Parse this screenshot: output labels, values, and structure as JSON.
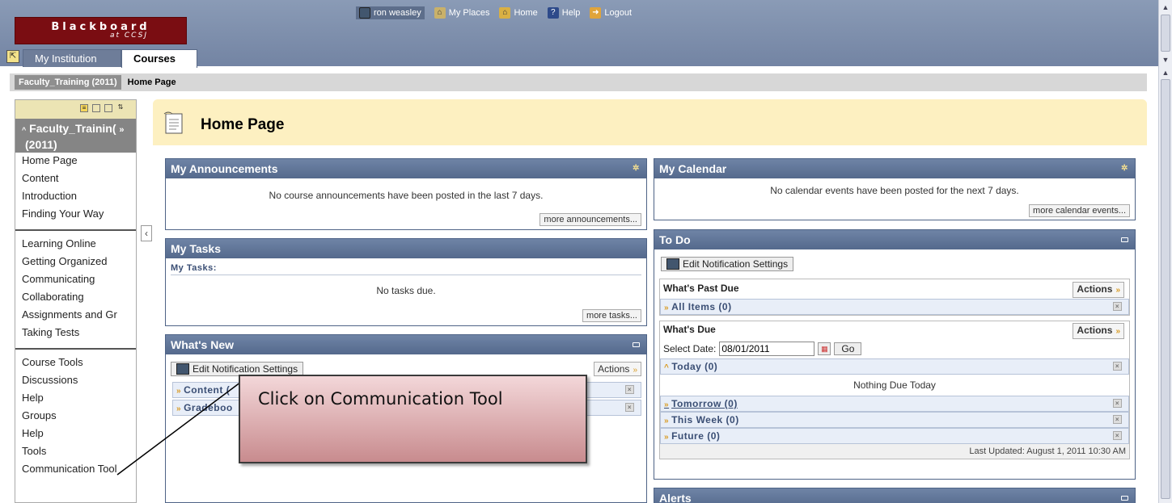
{
  "header": {
    "logo_line1": "Blackboard",
    "logo_line2": "at CCSJ",
    "user": "ron weasley",
    "links": [
      "My Places",
      "Home",
      "Help",
      "Logout"
    ]
  },
  "tabs": {
    "institution": "My Institution",
    "courses": "Courses"
  },
  "breadcrumb": {
    "course": "Faculty_Training (2011)",
    "page": "Home Page"
  },
  "course_menu": {
    "title": "Faculty_Training (2011)",
    "title_line1": "Faculty_Trainin(",
    "title_line2": "(2011)",
    "group1": [
      "Home Page",
      "Content",
      "Introduction",
      "Finding Your Way"
    ],
    "group2": [
      "Learning Online",
      "Getting Organized",
      "Communicating",
      "Collaborating",
      "Assignments and Gr",
      "Taking Tests"
    ],
    "group3": [
      "Course Tools",
      "Discussions",
      "Help",
      "Groups",
      "Help",
      "Tools",
      "Communication Tool"
    ]
  },
  "page_title": "Home Page",
  "announcements": {
    "title": "My Announcements",
    "message": "No course announcements have been posted in the last 7 days.",
    "more": "more announcements..."
  },
  "tasks": {
    "title": "My Tasks",
    "subheading": "My Tasks:",
    "message": "No tasks due.",
    "more": "more tasks..."
  },
  "whats_new": {
    "title": "What's New",
    "notify_button": "Edit Notification Settings",
    "actions": "Actions",
    "rows": [
      "Content (",
      "Gradeboo"
    ]
  },
  "calendar": {
    "title": "My Calendar",
    "message": "No calendar events have been posted for the next 7 days.",
    "more": "more calendar events..."
  },
  "todo": {
    "title": "To Do",
    "notify_button": "Edit Notification Settings",
    "past_due": "What's Past Due",
    "actions": "Actions",
    "all_items": "All Items (0)",
    "due": "What's Due",
    "select_date_label": "Select Date:",
    "date_value": "08/01/2011",
    "go": "Go",
    "today": "Today (0)",
    "nothing_due": "Nothing Due Today",
    "tomorrow": "Tomorrow (0)",
    "this_week": "This Week (0)",
    "future": "Future (0)",
    "last_updated": "Last Updated: August 1, 2011 10:30 AM"
  },
  "alerts": {
    "title": "Alerts"
  },
  "callout": {
    "text": "Click on Communication Tool"
  },
  "colors": {
    "header_blue": "#7f90ad",
    "module_header": "#5f7396",
    "logo_red": "#7a0d12",
    "page_head": "#fdf0c1",
    "callout_pink": "#e3b4b7"
  }
}
